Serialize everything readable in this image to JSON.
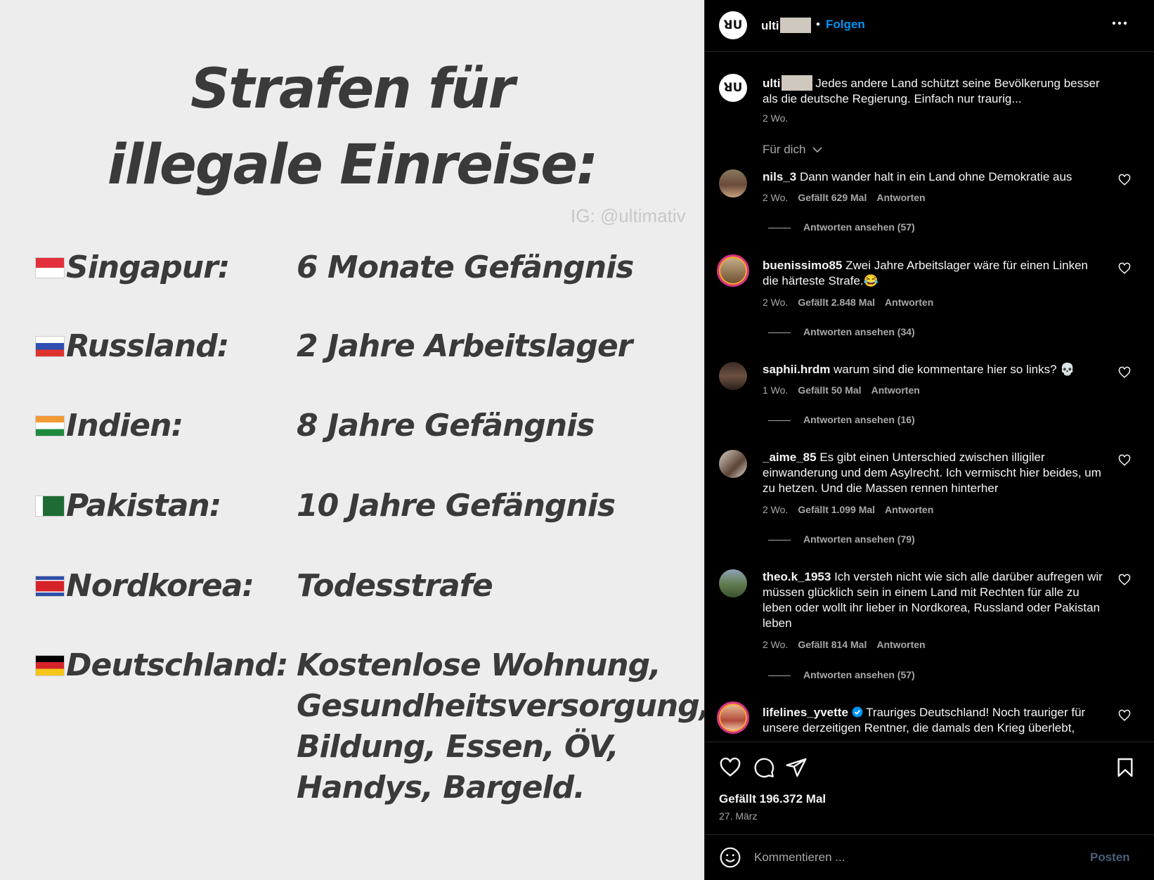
{
  "post_image": {
    "title_line1": "Strafen für",
    "title_line2": "illegale Einreise:",
    "watermark": "IG: @ultimativ",
    "rows": [
      {
        "flag": "singapore-flag",
        "country": "Singapur:",
        "penalty": "6 Monate Gefängnis"
      },
      {
        "flag": "russia-flag",
        "country": "Russland:",
        "penalty": "2 Jahre Arbeitslager"
      },
      {
        "flag": "india-flag",
        "country": "Indien:",
        "penalty": "8 Jahre Gefängnis"
      },
      {
        "flag": "pakistan-flag",
        "country": "Pakistan:",
        "penalty": "10 Jahre Gefängnis"
      },
      {
        "flag": "north-korea-flag",
        "country": "Nordkorea:",
        "penalty": "Todesstrafe"
      },
      {
        "flag": "germany-flag",
        "country": "Deutschland:",
        "penalty_lines": [
          "Kostenlose Wohnung,",
          "Gesundheitsversorgung,",
          "Bildung, Essen, ÖV,",
          "Handys, Bargeld."
        ]
      }
    ]
  },
  "header": {
    "username": "ulti",
    "separator": "•",
    "follow_label": "Folgen",
    "more_icon": "more-horizontal-icon",
    "avatar_text": "ꓤU"
  },
  "caption": {
    "username": "ulti",
    "text": "Jedes andere Land schützt seine Bevölkerung besser als die deutsche Regierung. Einfach nur traurig...",
    "time": "2 Wo."
  },
  "filter_label": "Für dich",
  "comments": [
    {
      "user": "nils_3",
      "text": "Dann wander halt in ein Land ohne Demokratie aus",
      "time": "2 Wo.",
      "likes": "Gefällt 629 Mal",
      "reply_label": "Antworten",
      "view_replies": "Antworten ansehen (57)"
    },
    {
      "user": "buenissimo85",
      "text": "Zwei Jahre Arbeitslager wäre für einen Linken die härteste Strafe.😂",
      "time": "2 Wo.",
      "likes": "Gefällt 2.848 Mal",
      "reply_label": "Antworten",
      "view_replies": "Antworten ansehen (34)"
    },
    {
      "user": "saphii.hrdm",
      "text": "warum sind die kommentare hier so links? 💀",
      "time": "1 Wo.",
      "likes": "Gefällt 50 Mal",
      "reply_label": "Antworten",
      "view_replies": "Antworten ansehen (16)"
    },
    {
      "user": "_aime_85",
      "text": "Es gibt einen Unterschied zwischen illigiler einwanderung und dem Asylrecht. Ich vermischt hier beides, um zu hetzen. Und die Massen rennen hinterher",
      "time": "2 Wo.",
      "likes": "Gefällt 1.099 Mal",
      "reply_label": "Antworten",
      "view_replies": "Antworten ansehen (79)"
    },
    {
      "user": "theo.k_1953",
      "text": "Ich versteh nicht wie sich alle darüber aufregen wir müssen glücklich sein in einem Land mit Rechten für alle zu leben oder wollt ihr lieber in Nordkorea, Russland oder Pakistan leben",
      "time": "2 Wo.",
      "likes": "Gefällt 814 Mal",
      "reply_label": "Antworten",
      "view_replies": "Antworten ansehen (57)"
    },
    {
      "user": "lifelines_yvette",
      "text": "Trauriges Deutschland! Noch trauriger für unsere derzeitigen Rentner, die damals den Krieg überlebt,",
      "time": "",
      "likes": "",
      "reply_label": "",
      "view_replies": ""
    }
  ],
  "actions": {
    "like_icon": "heart-icon",
    "comment_icon": "comment-icon",
    "share_icon": "send-icon",
    "save_icon": "bookmark-icon",
    "likes": "Gefällt 196.372 Mal",
    "date": "27. März"
  },
  "compose": {
    "placeholder": "Kommentieren ...",
    "post_label": "Posten",
    "emoji_icon": "emoji-icon"
  },
  "colors": {
    "accent": "#0095f6",
    "background": "#000000",
    "image_bg": "#ededee",
    "image_text": "#3a3a3a"
  }
}
